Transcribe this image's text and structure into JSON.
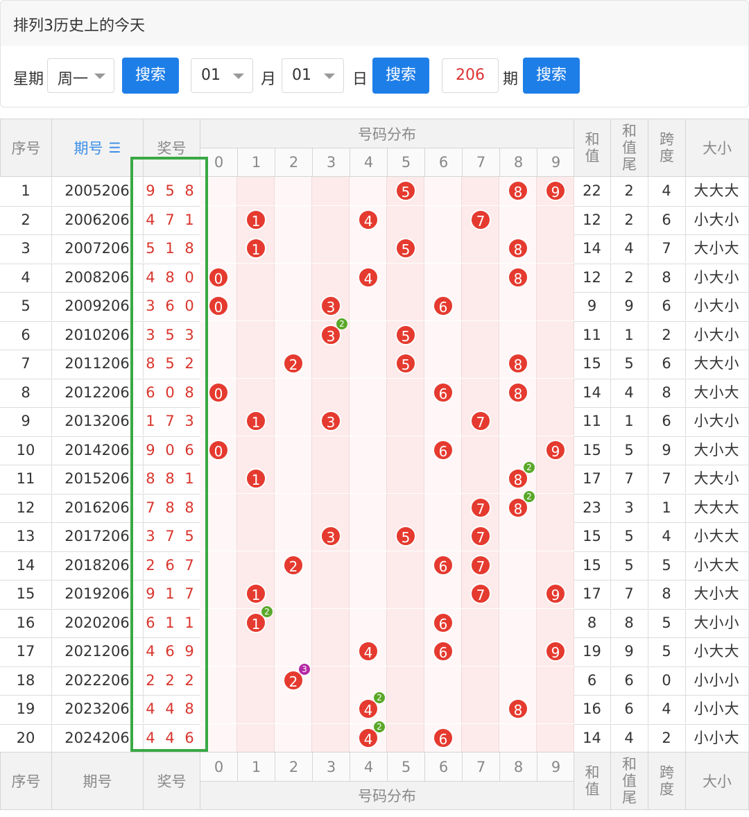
{
  "header": {
    "title": "排列3历史上的今天"
  },
  "search": {
    "weekday_label": "星期",
    "weekday_value": "周一",
    "search_label": "搜索",
    "month_value": "01",
    "month_label": "月",
    "day_value": "01",
    "day_label": "日",
    "period_value": "206",
    "period_label": "期"
  },
  "table": {
    "headers": {
      "index": "序号",
      "period": "期号",
      "period_sort_icon": "sort-icon",
      "prize": "奖号",
      "distribution": "号码分布",
      "sum": "和值",
      "sum_tail": "和值尾",
      "span": "跨度",
      "size": "大小"
    },
    "digits": [
      "0",
      "1",
      "2",
      "3",
      "4",
      "5",
      "6",
      "7",
      "8",
      "9"
    ],
    "rows": [
      {
        "idx": "1",
        "period": "2005206",
        "prize": "958",
        "sum": "22",
        "tail": "2",
        "span": "4",
        "size": "大大大"
      },
      {
        "idx": "2",
        "period": "2006206",
        "prize": "471",
        "sum": "12",
        "tail": "2",
        "span": "6",
        "size": "小大小"
      },
      {
        "idx": "3",
        "period": "2007206",
        "prize": "518",
        "sum": "14",
        "tail": "4",
        "span": "7",
        "size": "大小大"
      },
      {
        "idx": "4",
        "period": "2008206",
        "prize": "480",
        "sum": "12",
        "tail": "2",
        "span": "8",
        "size": "小大小"
      },
      {
        "idx": "5",
        "period": "2009206",
        "prize": "360",
        "sum": "9",
        "tail": "9",
        "span": "6",
        "size": "小大小"
      },
      {
        "idx": "6",
        "period": "2010206",
        "prize": "353",
        "sum": "11",
        "tail": "1",
        "span": "2",
        "size": "小大小"
      },
      {
        "idx": "7",
        "period": "2011206",
        "prize": "852",
        "sum": "15",
        "tail": "5",
        "span": "6",
        "size": "大大小"
      },
      {
        "idx": "8",
        "period": "2012206",
        "prize": "608",
        "sum": "14",
        "tail": "4",
        "span": "8",
        "size": "大小大"
      },
      {
        "idx": "9",
        "period": "2013206",
        "prize": "173",
        "sum": "11",
        "tail": "1",
        "span": "6",
        "size": "小大小"
      },
      {
        "idx": "10",
        "period": "2014206",
        "prize": "906",
        "sum": "15",
        "tail": "5",
        "span": "9",
        "size": "大小大"
      },
      {
        "idx": "11",
        "period": "2015206",
        "prize": "881",
        "sum": "17",
        "tail": "7",
        "span": "7",
        "size": "大大小"
      },
      {
        "idx": "12",
        "period": "2016206",
        "prize": "788",
        "sum": "23",
        "tail": "3",
        "span": "1",
        "size": "大大大"
      },
      {
        "idx": "13",
        "period": "2017206",
        "prize": "375",
        "sum": "15",
        "tail": "5",
        "span": "4",
        "size": "小大大"
      },
      {
        "idx": "14",
        "period": "2018206",
        "prize": "267",
        "sum": "15",
        "tail": "5",
        "span": "5",
        "size": "小大大"
      },
      {
        "idx": "15",
        "period": "2019206",
        "prize": "917",
        "sum": "17",
        "tail": "7",
        "span": "8",
        "size": "大小大"
      },
      {
        "idx": "16",
        "period": "2020206",
        "prize": "611",
        "sum": "8",
        "tail": "8",
        "span": "5",
        "size": "大小小"
      },
      {
        "idx": "17",
        "period": "2021206",
        "prize": "469",
        "sum": "19",
        "tail": "9",
        "span": "5",
        "size": "小大大"
      },
      {
        "idx": "18",
        "period": "2022206",
        "prize": "222",
        "sum": "6",
        "tail": "6",
        "span": "0",
        "size": "小小小"
      },
      {
        "idx": "19",
        "period": "2023206",
        "prize": "448",
        "sum": "16",
        "tail": "6",
        "span": "4",
        "size": "小小大"
      },
      {
        "idx": "20",
        "period": "2024206",
        "prize": "446",
        "sum": "14",
        "tail": "4",
        "span": "2",
        "size": "小小大"
      }
    ]
  },
  "colors": {
    "accent": "#1e7ee8",
    "ball": "#e53a2f",
    "prize_text": "#d9342c",
    "highlight_box": "#3aa845",
    "badge_double": "#5aa829",
    "badge_triple": "#b42aa5"
  }
}
